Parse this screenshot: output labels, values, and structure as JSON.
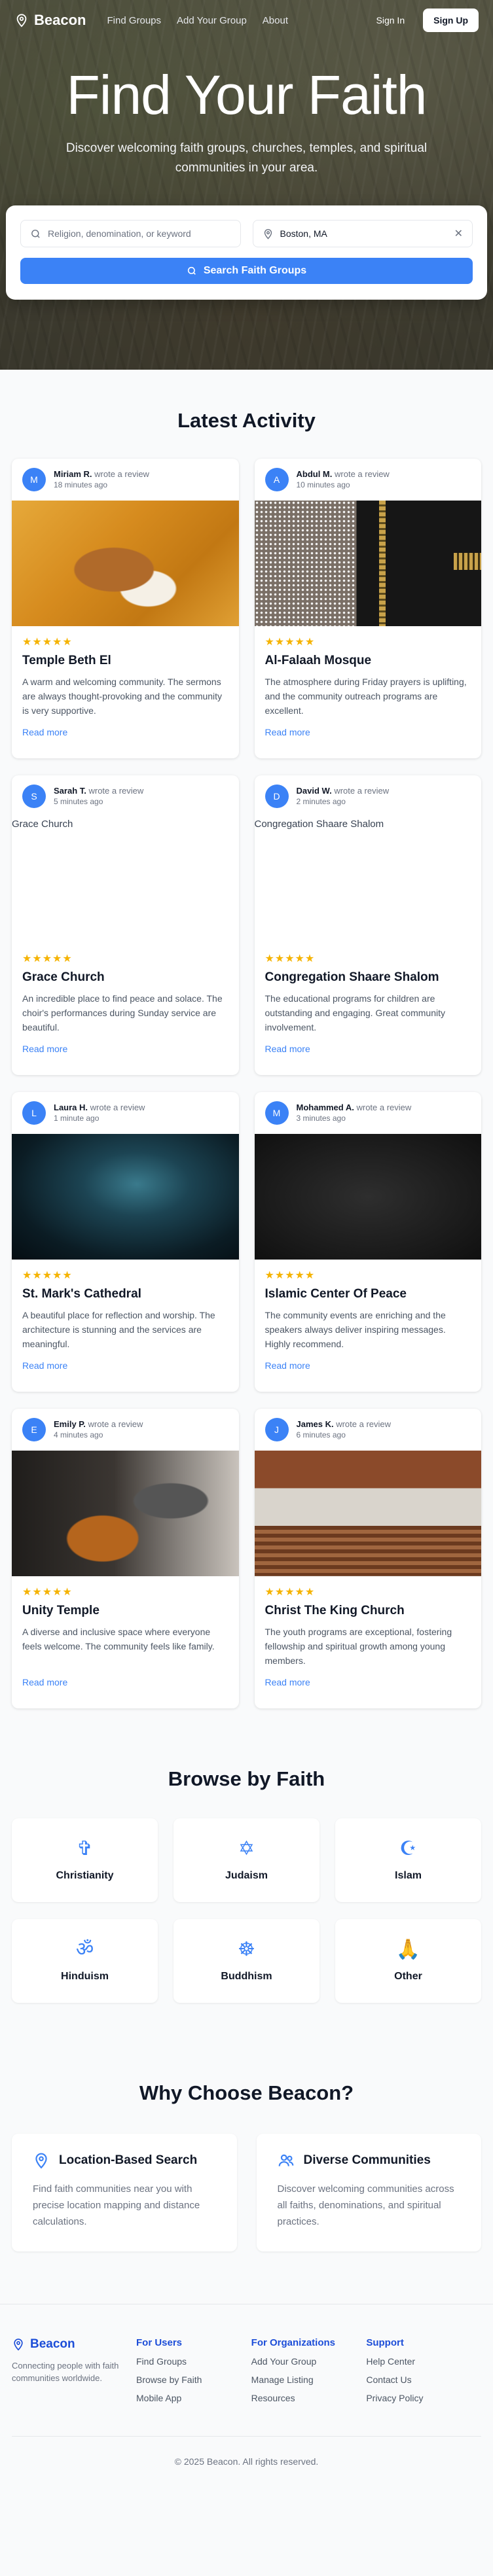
{
  "brand": "Beacon",
  "nav": {
    "links": [
      "Find Groups",
      "Add Your Group",
      "About"
    ],
    "signin": "Sign In",
    "signup": "Sign Up"
  },
  "hero": {
    "title": "Find Your Faith",
    "subtitle": "Discover welcoming faith groups, churches, temples, and spiritual communities in your area."
  },
  "search": {
    "query_placeholder": "Religion, denomination, or keyword",
    "location_value": "Boston, MA",
    "clear_symbol": "✕",
    "button": "Search Faith Groups"
  },
  "activity": {
    "title": "Latest Activity",
    "wrote": "wrote a review",
    "read_more": "Read more",
    "stars": "★★★★★",
    "items": [
      {
        "initial": "M",
        "user": "Miriam R.",
        "time": "18 minutes ago",
        "place": "Temple Beth El",
        "image_alt": "",
        "review": "A warm and welcoming community. The sermons are always thought-provoking and the community is very supportive."
      },
      {
        "initial": "A",
        "user": "Abdul M.",
        "time": "10 minutes ago",
        "place": "Al-Falaah Mosque",
        "image_alt": "",
        "review": "The atmosphere during Friday prayers is uplifting, and the community outreach programs are excellent."
      },
      {
        "initial": "S",
        "user": "Sarah T.",
        "time": "5 minutes ago",
        "place": "Grace Church",
        "image_alt": "Grace Church",
        "review": "An incredible place to find peace and solace. The choir's performances during Sunday service are beautiful."
      },
      {
        "initial": "D",
        "user": "David W.",
        "time": "2 minutes ago",
        "place": "Congregation Shaare Shalom",
        "image_alt": "Congregation Shaare Shalom",
        "review": "The educational programs for children are outstanding and engaging. Great community involvement."
      },
      {
        "initial": "L",
        "user": "Laura H.",
        "time": "1 minute ago",
        "place": "St. Mark's Cathedral",
        "image_alt": "",
        "review": "A beautiful place for reflection and worship. The architecture is stunning and the services are meaningful."
      },
      {
        "initial": "M",
        "user": "Mohammed A.",
        "time": "3 minutes ago",
        "place": "Islamic Center Of Peace",
        "image_alt": "",
        "review": "The community events are enriching and the speakers always deliver inspiring messages. Highly recommend."
      },
      {
        "initial": "E",
        "user": "Emily P.",
        "time": "4 minutes ago",
        "place": "Unity Temple",
        "image_alt": "",
        "review": "A diverse and inclusive space where everyone feels welcome. The community feels like family."
      },
      {
        "initial": "J",
        "user": "James K.",
        "time": "6 minutes ago",
        "place": "Christ The King Church",
        "image_alt": "",
        "review": "The youth programs are exceptional, fostering fellowship and spiritual growth among young members."
      }
    ]
  },
  "browse": {
    "title": "Browse by Faith",
    "faiths": [
      {
        "label": "Christianity",
        "symbol": "✞"
      },
      {
        "label": "Judaism",
        "symbol": "✡"
      },
      {
        "label": "Islam",
        "symbol": "☪"
      },
      {
        "label": "Hinduism",
        "symbol": "ॐ"
      },
      {
        "label": "Buddhism",
        "symbol": "☸"
      },
      {
        "label": "Other",
        "symbol": "🙏"
      }
    ]
  },
  "why": {
    "title": "Why Choose Beacon?",
    "cards": [
      {
        "title": "Location-Based Search",
        "text": "Find faith communities near you with precise location mapping and distance calculations."
      },
      {
        "title": "Diverse Communities",
        "text": "Discover welcoming communities across all faiths, denominations, and spiritual practices."
      }
    ]
  },
  "footer": {
    "tagline": "Connecting people with faith communities worldwide.",
    "columns": [
      {
        "heading": "For Users",
        "links": [
          "Find Groups",
          "Browse by Faith",
          "Mobile App"
        ]
      },
      {
        "heading": "For Organizations",
        "links": [
          "Add Your Group",
          "Manage Listing",
          "Resources"
        ]
      },
      {
        "heading": "Support",
        "links": [
          "Help Center",
          "Contact Us",
          "Privacy Policy"
        ]
      }
    ],
    "copyright": "© 2025 Beacon. All rights reserved."
  },
  "colors": {
    "accent": "#3b82f6",
    "star": "#f5b301",
    "footer_heading": "#1d4ed8"
  }
}
